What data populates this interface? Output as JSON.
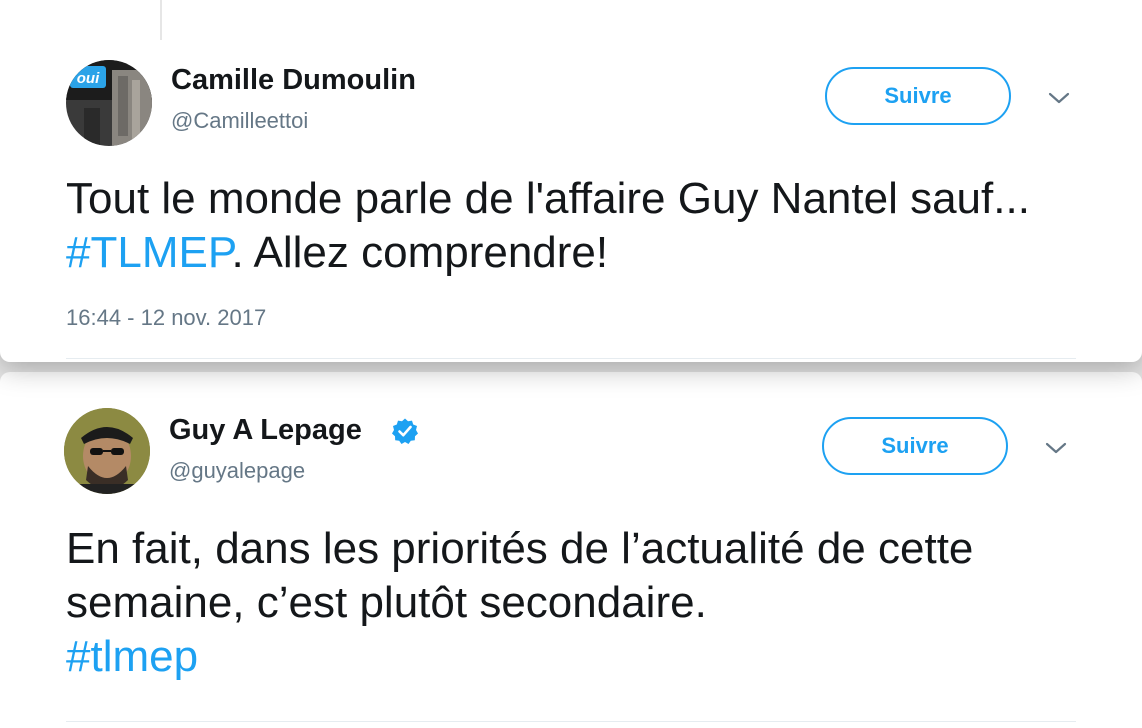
{
  "tweets": [
    {
      "author": {
        "name": "Camille Dumoulin",
        "handle": "@Camilleettoi",
        "verified": false,
        "avatar_badge_text": "oui"
      },
      "follow_label": "Suivre",
      "text_parts": [
        {
          "text": "Tout le monde parle de l'affaire Guy Nantel sauf... ",
          "type": "text"
        },
        {
          "text": "#TLMEP",
          "type": "hashtag"
        },
        {
          "text": ". Allez comprendre!",
          "type": "text"
        }
      ],
      "timestamp": "16:44 - 12 nov. 2017"
    },
    {
      "author": {
        "name": "Guy A Lepage",
        "handle": "@guyalepage",
        "verified": true
      },
      "follow_label": "Suivre",
      "text_parts": [
        {
          "text": "En fait, dans les priorités de l’actualité de cette semaine, c’est plutôt secondaire.",
          "type": "text"
        },
        {
          "text": "#tlmep",
          "type": "hashtag"
        }
      ]
    }
  ],
  "colors": {
    "accent": "#1da1f2",
    "text": "#14171a",
    "secondary": "#657786",
    "background": "#e4e4e4"
  },
  "icons": [
    "verified-badge-icon",
    "chevron-down-icon"
  ]
}
